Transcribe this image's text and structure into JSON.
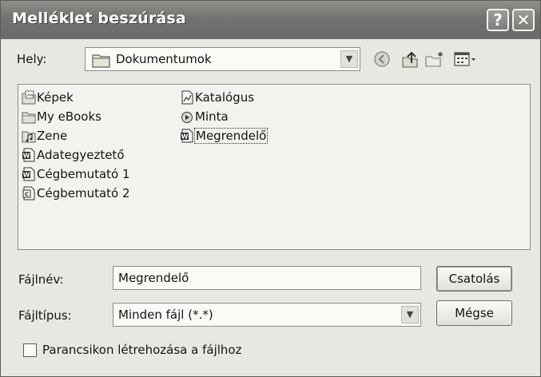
{
  "window": {
    "title": "Melléklet beszúrása",
    "help_glyph": "?",
    "close_glyph": "✕"
  },
  "location": {
    "label": "Hely:",
    "value": "Dokumentumok",
    "dropdown_glyph": "▼",
    "icons": [
      "folder-icon",
      "back-icon",
      "up-folder-icon",
      "new-folder-icon",
      "views-menu-icon"
    ]
  },
  "files": [
    {
      "name": "Képek",
      "icon": "image-folder-icon"
    },
    {
      "name": "My eBooks",
      "icon": "folder-icon"
    },
    {
      "name": "Zene",
      "icon": "music-folder-icon"
    },
    {
      "name": "Adategyeztető",
      "icon": "word-document-icon"
    },
    {
      "name": "Cégbemutató 1",
      "icon": "word-document-icon"
    },
    {
      "name": "Cégbemutató 2",
      "icon": "document-icon"
    },
    {
      "name": "Katalógus",
      "icon": "chart-document-icon"
    },
    {
      "name": "Minta",
      "icon": "media-file-icon"
    },
    {
      "name": "Megrendelő",
      "icon": "word-document-icon",
      "selected": true
    }
  ],
  "filename": {
    "label": "Fájlnév:",
    "value": "Megrendelő"
  },
  "filetype": {
    "label": "Fájltípus:",
    "value": "Minden fájl (*.*)",
    "dropdown_glyph": "▼"
  },
  "buttons": {
    "attach": "Csatolás",
    "cancel": "Mégse"
  },
  "shortcut": {
    "label": "Parancsikon létrehozása a fájlhoz",
    "checked": false
  }
}
